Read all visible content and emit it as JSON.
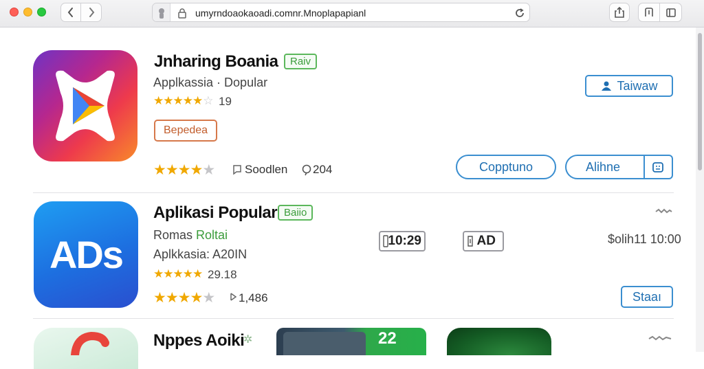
{
  "browser": {
    "url": "umyrndoaokaoadi.comnr.Mnoplapapianl"
  },
  "apps": [
    {
      "title": "Jnharing Boania",
      "badge": "Raiv",
      "subtitle": "Applkassia · Dopular",
      "rating_top": "19",
      "tag": "Bepedea",
      "rating_bottom_label": "Soodlen",
      "reviews": "204",
      "primary_button": "Taiwaw",
      "button_left": "Copptuno",
      "button_right": "Alihne",
      "star_rating": 4
    },
    {
      "title": "Aplikasi Popular",
      "badge": "Baiio",
      "subtitle_prefix": "Romas",
      "subtitle_highlight": "Roltai",
      "category": "Aplkkasia: A20IN",
      "rating_top": "29.18",
      "reviews": "1,486",
      "chip_time": "10:29",
      "chip_ad": "AD",
      "price": "$olih11 10:00",
      "icon_text": "ADs",
      "primary_button": "Staaı",
      "star_rating": 4
    },
    {
      "title": "Nppes Aoiki",
      "tile_number": "22"
    }
  ],
  "colors": {
    "accent_blue": "#3a8ed0",
    "badge_green": "#5bb75b",
    "badge_orange": "#d6784a",
    "star": "#f0a800"
  }
}
